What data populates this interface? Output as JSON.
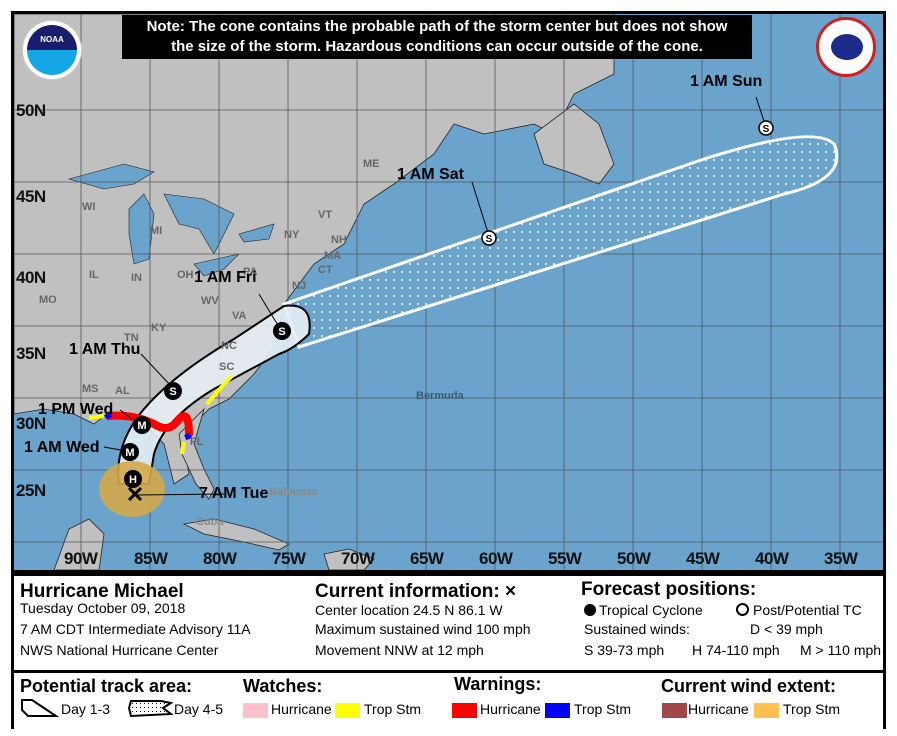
{
  "note": {
    "line1": "Note: The cone contains the probable path of the storm center but does not show",
    "line2": "the size of the storm. Hazardous conditions can occur outside of the cone."
  },
  "logos": {
    "left": "NOAA",
    "right": "National Weather Service"
  },
  "map": {
    "colors": {
      "ocean": "#6aa3cc",
      "land": "#c0c0c0",
      "cone_day13": "#e6eef5",
      "grid": "#555555"
    },
    "lat_labels": [
      "50N",
      "45N",
      "40N",
      "35N",
      "30N",
      "25N"
    ],
    "lon_labels": [
      "90W",
      "85W",
      "80W",
      "75W",
      "70W",
      "65W",
      "60W",
      "55W",
      "50W",
      "45W",
      "40W",
      "35W"
    ],
    "state_labels": [
      "WI",
      "MI",
      "IL",
      "IN",
      "OH",
      "MO",
      "KY",
      "WV",
      "VA",
      "TN",
      "NC",
      "SC",
      "MS",
      "AL",
      "FL",
      "PA",
      "NY",
      "VT",
      "NH",
      "MA",
      "CT",
      "ME",
      "NJ"
    ],
    "place_labels": {
      "bermuda": "Bermuda",
      "bahamas": "Bahamas",
      "cuba": "Cuba"
    },
    "track_points": [
      {
        "time": "7 AM Tue",
        "symbol": "X",
        "type": "current"
      },
      {
        "time": "",
        "symbol": "H",
        "type": "tropical"
      },
      {
        "time": "1 AM Wed",
        "symbol": "M",
        "type": "tropical"
      },
      {
        "time": "1 PM Wed",
        "symbol": "M",
        "type": "tropical"
      },
      {
        "time": "1 AM Thu",
        "symbol": "S",
        "type": "tropical"
      },
      {
        "time": "1 AM Fri",
        "symbol": "S",
        "type": "tropical"
      },
      {
        "time": "1 AM Sat",
        "symbol": "S",
        "type": "post"
      },
      {
        "time": "1 AM Sun",
        "symbol": "S",
        "type": "post"
      }
    ]
  },
  "info": {
    "storm_name": "Hurricane Michael",
    "date": "Tuesday October 09, 2018",
    "advisory": "7 AM CDT Intermediate Advisory 11A",
    "source": "NWS National Hurricane Center",
    "current_title": "Current information:",
    "current_symbol": "×",
    "center_location": "Center location 24.5 N 86.1 W",
    "max_wind": "Maximum sustained wind 100 mph",
    "movement": "Movement NNW at 12 mph",
    "forecast_title": "Forecast positions:",
    "tropical_cyclone": "Tropical Cyclone",
    "post_tc": "Post/Potential TC",
    "sustained_winds": "Sustained winds:",
    "d_range": "D < 39 mph",
    "s_range": "S 39-73 mph",
    "h_range": "H 74-110 mph",
    "m_range": "M > 110 mph"
  },
  "legend": {
    "track_title": "Potential track area:",
    "day13": "Day 1-3",
    "day45": "Day 4-5",
    "watches_title": "Watches:",
    "watch_hurricane": "Hurricane",
    "watch_tropstm": "Trop Stm",
    "warnings_title": "Warnings:",
    "warn_hurricane": "Hurricane",
    "warn_tropstm": "Trop Stm",
    "wind_title": "Current wind extent:",
    "wind_hurricane": "Hurricane",
    "wind_tropstm": "Trop Stm",
    "colors": {
      "watch_hurricane": "#ffc0cb",
      "watch_tropstm": "#ffff00",
      "warn_hurricane": "#ff0000",
      "warn_tropstm": "#0000ff",
      "wind_hurricane": "#a04848",
      "wind_tropstm": "#ffc050"
    }
  }
}
